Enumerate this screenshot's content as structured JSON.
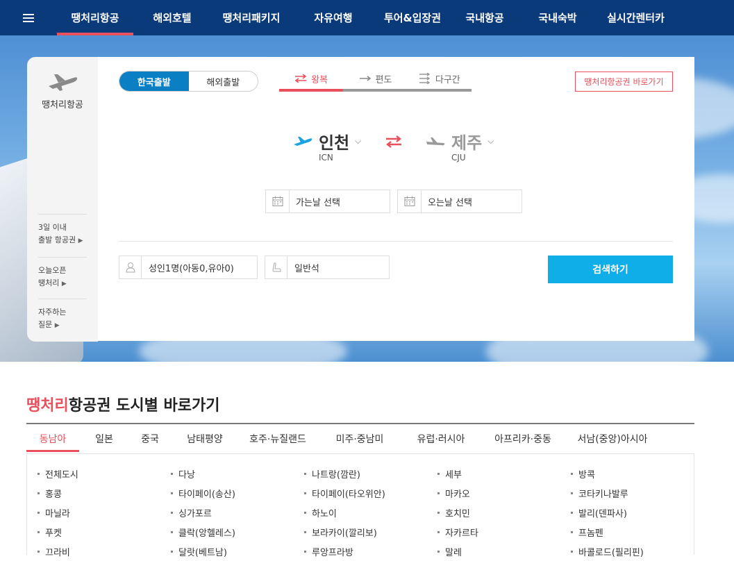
{
  "nav": {
    "items": [
      {
        "label": "땡처리항공",
        "active": true
      },
      {
        "label": "해외호텔"
      },
      {
        "label": "땡처리패키지"
      },
      {
        "label": "자유여행"
      },
      {
        "label": "투어&입장권"
      },
      {
        "label": "국내항공"
      },
      {
        "label": "국내숙박"
      },
      {
        "label": "실시간렌터카"
      }
    ]
  },
  "side": {
    "title": "땡처리항공",
    "links": [
      {
        "line1": "3일 이내",
        "line2": "출발 항공권"
      },
      {
        "line1": "오늘오픈",
        "line2": "땡처리"
      },
      {
        "line1": "자주하는",
        "line2": "질문"
      }
    ]
  },
  "search": {
    "origin_tabs": [
      "한국출발",
      "해외출발"
    ],
    "trip_types": [
      "왕복",
      "편도",
      "다구간"
    ],
    "shortcut_button": "땡처리항공권 바로가기",
    "from": {
      "city": "인천",
      "code": "ICN"
    },
    "to": {
      "city": "제주",
      "code": "CJU"
    },
    "depart_placeholder": "가는날 선택",
    "return_placeholder": "오는날 선택",
    "passengers": "성인1명(아동0,유아0)",
    "cabin": "일반석",
    "search_button": "검색하기"
  },
  "cities": {
    "title_highlight": "땡처리",
    "title_rest": "항공권 도시별 바로가기",
    "regions": [
      "동남아",
      "일본",
      "중국",
      "남태평양",
      "호주·뉴질랜드",
      "미주·중남미",
      "유럽·러시아",
      "아프리카·중동",
      "서남(중앙)아시아"
    ],
    "list": [
      "전체도시",
      "다낭",
      "나트랑(깜란)",
      "세부",
      "방콕",
      "홍콩",
      "타이페이(송산)",
      "타이페이(타오위안)",
      "마카오",
      "코타키나발루",
      "마닐라",
      "싱가포르",
      "하노이",
      "호치민",
      "발리(덴파사)",
      "푸켓",
      "클락(앙헬레스)",
      "보라카이(깔리보)",
      "자카르타",
      "프놈펜",
      "끄라비",
      "달랏(베트남)",
      "루앙프라방",
      "말레",
      "바콜로드(필리핀)"
    ]
  },
  "colors": {
    "nav_bg": "#0b3a7a",
    "accent_red": "#e8505b",
    "accent_blue": "#0b7fc4",
    "search_btn": "#10aee8"
  }
}
